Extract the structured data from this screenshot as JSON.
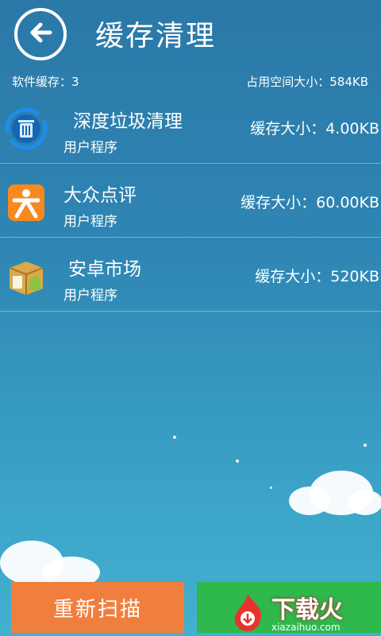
{
  "header": {
    "title": "缓存清理",
    "back_icon": "arrow-left-circle-icon"
  },
  "summary": {
    "software_cache": "软件缓存：3",
    "used_space": "占用空间大小：584KB"
  },
  "items": [
    {
      "name": "深度垃圾清理",
      "type": "用户程序",
      "cache": "缓存大小：4.00KB",
      "icon": "trash-refresh-icon"
    },
    {
      "name": "大众点评",
      "type": "用户程序",
      "cache": "缓存大小：60.00KB",
      "icon": "dianping-icon"
    },
    {
      "name": "安卓市场",
      "type": "用户程序",
      "cache": "缓存大小：520KB",
      "icon": "android-market-icon"
    }
  ],
  "buttons": {
    "rescan": "重新扫描",
    "clean": ""
  },
  "watermark": {
    "logo": "下载火",
    "url": "xiazaihuo.com"
  },
  "colors": {
    "background_top": "#2a78a8",
    "background_bottom": "#43b0cf",
    "rescan_button": "#f07f3e",
    "clean_button": "#2fb84b"
  }
}
